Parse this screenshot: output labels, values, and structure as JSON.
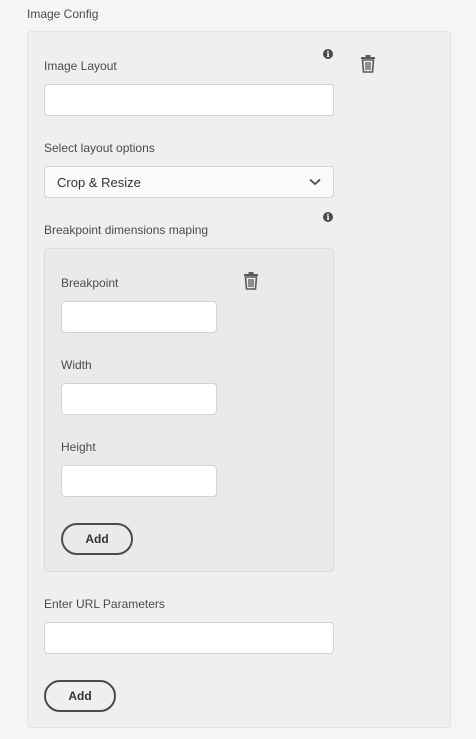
{
  "section": {
    "title": "Image Config"
  },
  "image_layout": {
    "label": "Image Layout",
    "value": ""
  },
  "layout_options": {
    "label": "Select layout options",
    "selected": "Crop & Resize"
  },
  "breakpoint_mapping": {
    "label": "Breakpoint dimensions maping",
    "breakpoint": {
      "label": "Breakpoint",
      "value": ""
    },
    "width": {
      "label": "Width",
      "value": ""
    },
    "height": {
      "label": "Height",
      "value": ""
    },
    "add_label": "Add"
  },
  "url_params": {
    "label": "Enter URL Parameters",
    "value": ""
  },
  "add_label": "Add",
  "icons": {
    "info": "info-icon",
    "delete": "trash-icon",
    "dropdown": "chevron-down-icon",
    "info_glyph": "i"
  },
  "colors": {
    "page_bg": "#f5f5f5",
    "panel_bg": "#efefef",
    "inner_panel_bg": "#eaeaea",
    "text": "#4b4b4b"
  }
}
